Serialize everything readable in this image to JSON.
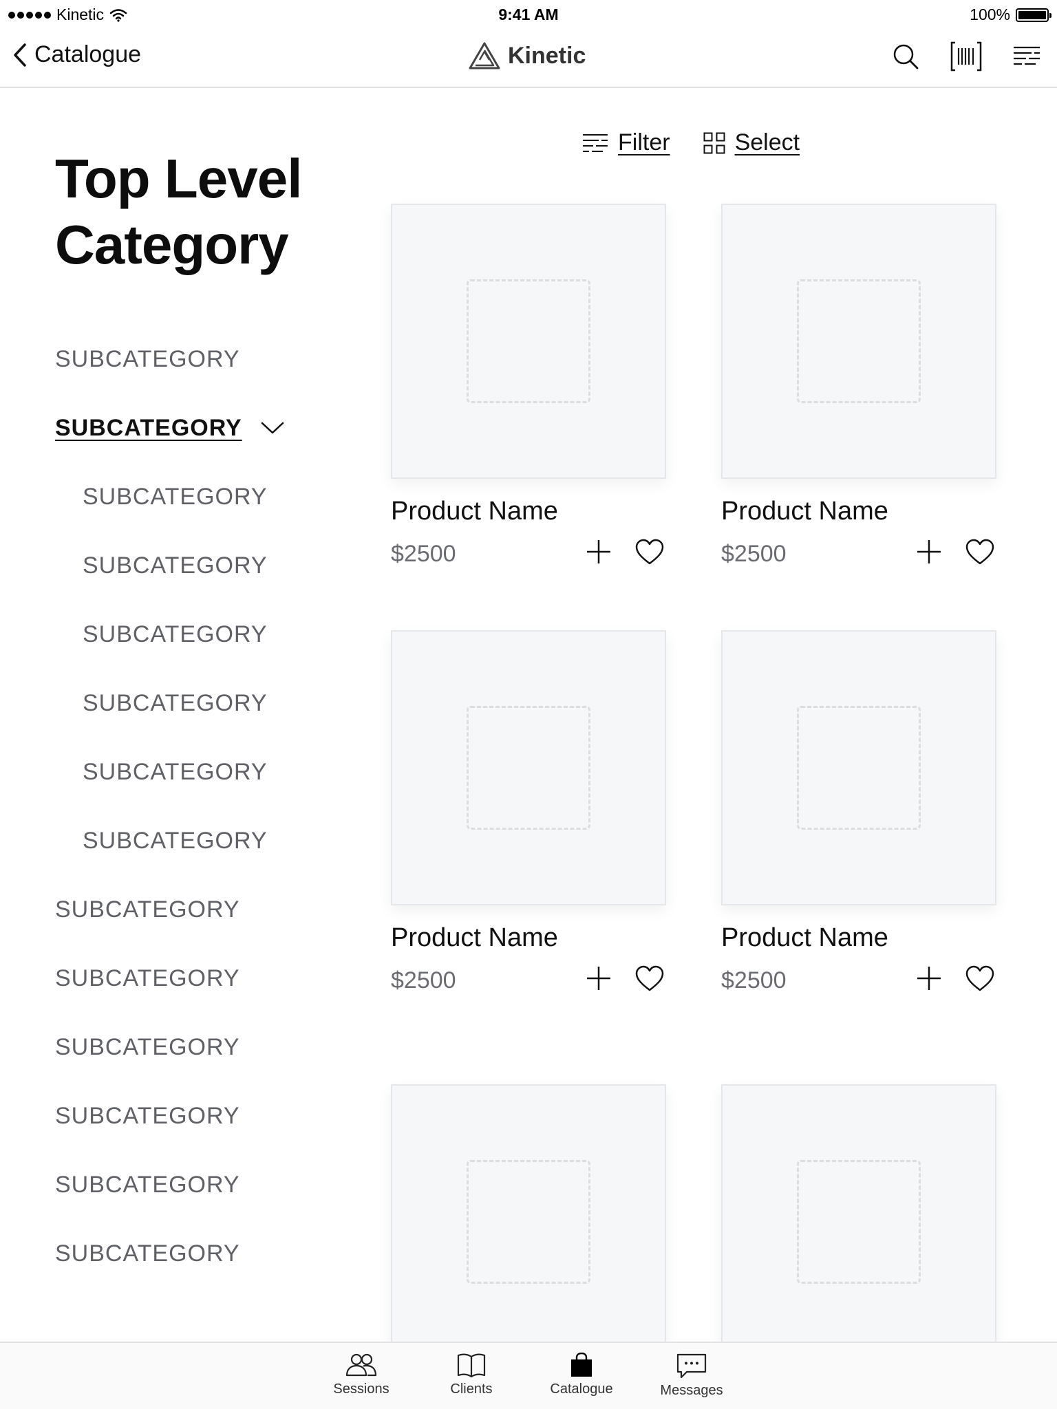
{
  "status_bar": {
    "carrier": "Kinetic",
    "time": "9:41 AM",
    "battery": "100%",
    "battery_level": 1.0
  },
  "nav": {
    "back_label": "Catalogue",
    "brand_name": "Kinetic",
    "icons": [
      "search-icon",
      "barcode-icon",
      "menu-list-icon"
    ]
  },
  "category": {
    "title_line1": "Top Level",
    "title_line2": "Category"
  },
  "subcategories": [
    {
      "label": "SUBCATEGORY",
      "level": 0
    },
    {
      "label": "SUBCATEGORY",
      "level": 0,
      "expanded": true,
      "active": true
    },
    {
      "label": "SUBCATEGORY",
      "level": 1
    },
    {
      "label": "SUBCATEGORY",
      "level": 1
    },
    {
      "label": "SUBCATEGORY",
      "level": 1
    },
    {
      "label": "SUBCATEGORY",
      "level": 1
    },
    {
      "label": "SUBCATEGORY",
      "level": 1
    },
    {
      "label": "SUBCATEGORY",
      "level": 1
    },
    {
      "label": "SUBCATEGORY",
      "level": 0
    },
    {
      "label": "SUBCATEGORY",
      "level": 0
    },
    {
      "label": "SUBCATEGORY",
      "level": 0
    },
    {
      "label": "SUBCATEGORY",
      "level": 0
    },
    {
      "label": "SUBCATEGORY",
      "level": 0
    },
    {
      "label": "SUBCATEGORY",
      "level": 0
    }
  ],
  "toolbar": {
    "filter_label": "Filter",
    "select_label": "Select"
  },
  "products": [
    {
      "name": "Product Name",
      "price": "$2500"
    },
    {
      "name": "Product Name",
      "price": "$2500"
    },
    {
      "name": "Product Name",
      "price": "$2500"
    },
    {
      "name": "Product Name",
      "price": "$2500"
    },
    {
      "name": "",
      "price": ""
    },
    {
      "name": "",
      "price": ""
    }
  ],
  "tabs": [
    {
      "label": "Sessions",
      "icon": "people-icon"
    },
    {
      "label": "Clients",
      "icon": "book-icon"
    },
    {
      "label": "Catalogue",
      "icon": "shopping-bag-icon",
      "active": true
    },
    {
      "label": "Messages",
      "icon": "chat-bubble-icon"
    }
  ]
}
